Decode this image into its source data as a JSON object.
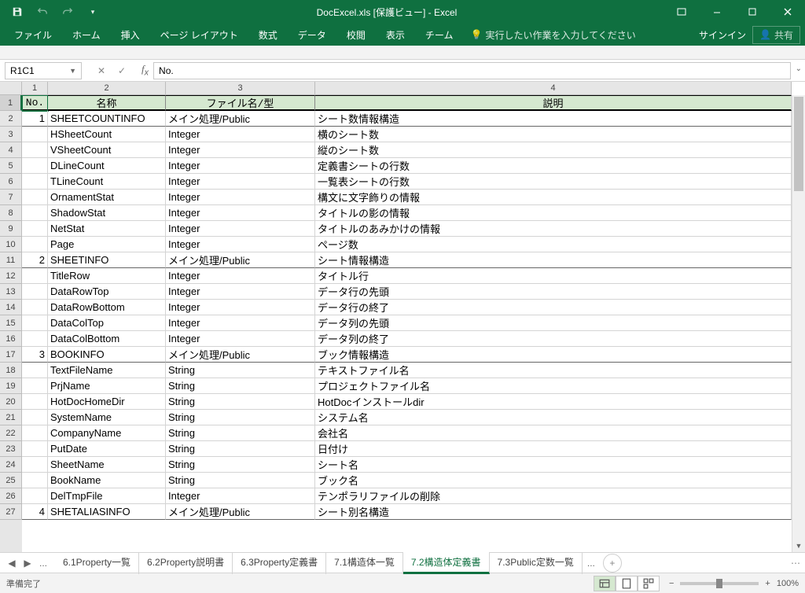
{
  "title": "DocExcel.xls  [保護ビュー] - Excel",
  "ribbon": {
    "tabs": [
      "ファイル",
      "ホーム",
      "挿入",
      "ページ レイアウト",
      "数式",
      "データ",
      "校閲",
      "表示",
      "チーム"
    ],
    "tellme": "実行したい作業を入力してください",
    "signin": "サインイン",
    "share": "共有"
  },
  "namebox": "R1C1",
  "formula": "No.",
  "colHeaders": [
    "1",
    "2",
    "3",
    "4"
  ],
  "headerRow": {
    "no": "No.",
    "name": "名称",
    "type": "ファイル名/型",
    "desc": "説明"
  },
  "rows": [
    {
      "r": "2",
      "no": "1",
      "name": "SHEETCOUNTINFO",
      "type": "メイン処理/Public",
      "desc": "シート数情報構造",
      "sec": true
    },
    {
      "r": "3",
      "no": "",
      "name": "HSheetCount",
      "type": "Integer",
      "desc": "横のシート数"
    },
    {
      "r": "4",
      "no": "",
      "name": "VSheetCount",
      "type": "Integer",
      "desc": "縦のシート数"
    },
    {
      "r": "5",
      "no": "",
      "name": "DLineCount",
      "type": "Integer",
      "desc": "定義書シートの行数"
    },
    {
      "r": "6",
      "no": "",
      "name": "TLineCount",
      "type": "Integer",
      "desc": "一覧表シートの行数"
    },
    {
      "r": "7",
      "no": "",
      "name": "OrnamentStat",
      "type": "Integer",
      "desc": "構文に文字飾りの情報"
    },
    {
      "r": "8",
      "no": "",
      "name": "ShadowStat",
      "type": "Integer",
      "desc": "タイトルの影の情報"
    },
    {
      "r": "9",
      "no": "",
      "name": "NetStat",
      "type": "Integer",
      "desc": "タイトルのあみかけの情報"
    },
    {
      "r": "10",
      "no": "",
      "name": "Page",
      "type": "Integer",
      "desc": "ページ数"
    },
    {
      "r": "11",
      "no": "2",
      "name": "SHEETINFO",
      "type": "メイン処理/Public",
      "desc": "シート情報構造",
      "sec": true
    },
    {
      "r": "12",
      "no": "",
      "name": "TitleRow",
      "type": "Integer",
      "desc": "タイトル行"
    },
    {
      "r": "13",
      "no": "",
      "name": "DataRowTop",
      "type": "Integer",
      "desc": "データ行の先頭"
    },
    {
      "r": "14",
      "no": "",
      "name": "DataRowBottom",
      "type": "Integer",
      "desc": "データ行の終了"
    },
    {
      "r": "15",
      "no": "",
      "name": "DataColTop",
      "type": "Integer",
      "desc": "データ列の先頭"
    },
    {
      "r": "16",
      "no": "",
      "name": "DataColBottom",
      "type": "Integer",
      "desc": "データ列の終了"
    },
    {
      "r": "17",
      "no": "3",
      "name": "BOOKINFO",
      "type": "メイン処理/Public",
      "desc": "ブック情報構造",
      "sec": true
    },
    {
      "r": "18",
      "no": "",
      "name": "TextFileName",
      "type": "String",
      "desc": "テキストファイル名"
    },
    {
      "r": "19",
      "no": "",
      "name": "PrjName",
      "type": "String",
      "desc": "プロジェクトファイル名"
    },
    {
      "r": "20",
      "no": "",
      "name": "HotDocHomeDir",
      "type": "String",
      "desc": "HotDocインストールdir"
    },
    {
      "r": "21",
      "no": "",
      "name": "SystemName",
      "type": "String",
      "desc": "システム名"
    },
    {
      "r": "22",
      "no": "",
      "name": "CompanyName",
      "type": "String",
      "desc": "会社名"
    },
    {
      "r": "23",
      "no": "",
      "name": "PutDate",
      "type": "String",
      "desc": "日付け"
    },
    {
      "r": "24",
      "no": "",
      "name": "SheetName",
      "type": "String",
      "desc": "シート名"
    },
    {
      "r": "25",
      "no": "",
      "name": "BookName",
      "type": "String",
      "desc": "ブック名"
    },
    {
      "r": "26",
      "no": "",
      "name": "DelTmpFile",
      "type": "Integer",
      "desc": "テンポラリファイルの削除"
    },
    {
      "r": "27",
      "no": "4",
      "name": "SHETALIASINFO",
      "type": "メイン処理/Public",
      "desc": "シート別名構造",
      "sec": true
    }
  ],
  "tabs": {
    "list": [
      "6.1Property一覧",
      "6.2Property説明書",
      "6.3Property定義書",
      "7.1構造体一覧",
      "7.2構造体定義書",
      "7.3Public定数一覧"
    ],
    "active": 4,
    "more": "..."
  },
  "status": {
    "ready": "準備完了",
    "zoom": "100%"
  }
}
